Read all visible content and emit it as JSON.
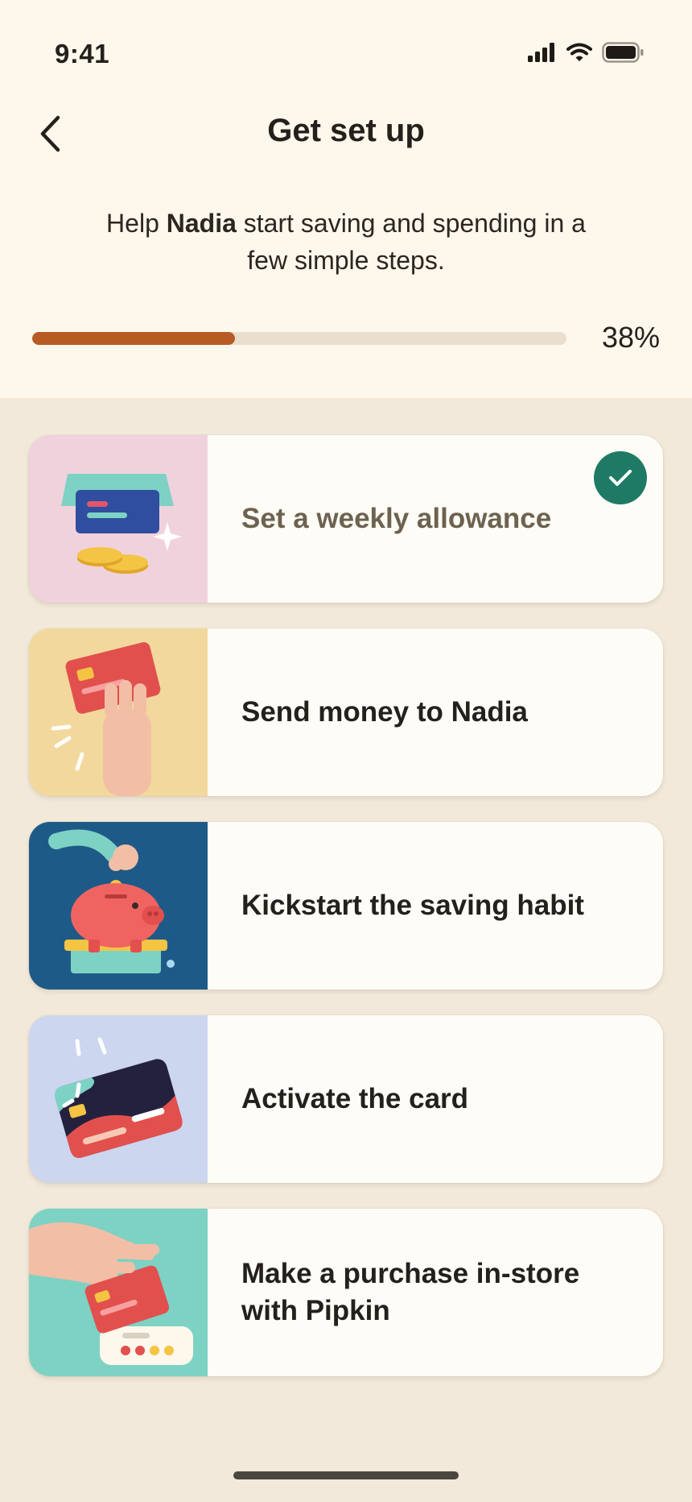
{
  "status_bar": {
    "time": "9:41"
  },
  "header": {
    "title": "Get set up"
  },
  "intro": {
    "prefix": "Help ",
    "name": "Nadia",
    "suffix": " start saving and spending in a few simple steps."
  },
  "progress": {
    "percent": 38,
    "label": "38%"
  },
  "steps": [
    {
      "label": "Set a weekly allowance",
      "completed": true,
      "art_bg": "#f0d2dc"
    },
    {
      "label": "Send money to Nadia",
      "completed": false,
      "art_bg": "#f2d89c"
    },
    {
      "label": "Kickstart the saving habit",
      "completed": false,
      "art_bg": "#1e5a88"
    },
    {
      "label": "Activate the card",
      "completed": false,
      "art_bg": "#ccd6ee"
    },
    {
      "label": "Make a purchase in-store with Pipkin",
      "completed": false,
      "art_bg": "#7dd2c4"
    }
  ],
  "colors": {
    "accent": "#b85a24",
    "check": "#1f7a65",
    "background": "#f2e9da",
    "header_bg": "#fdf7ec"
  }
}
